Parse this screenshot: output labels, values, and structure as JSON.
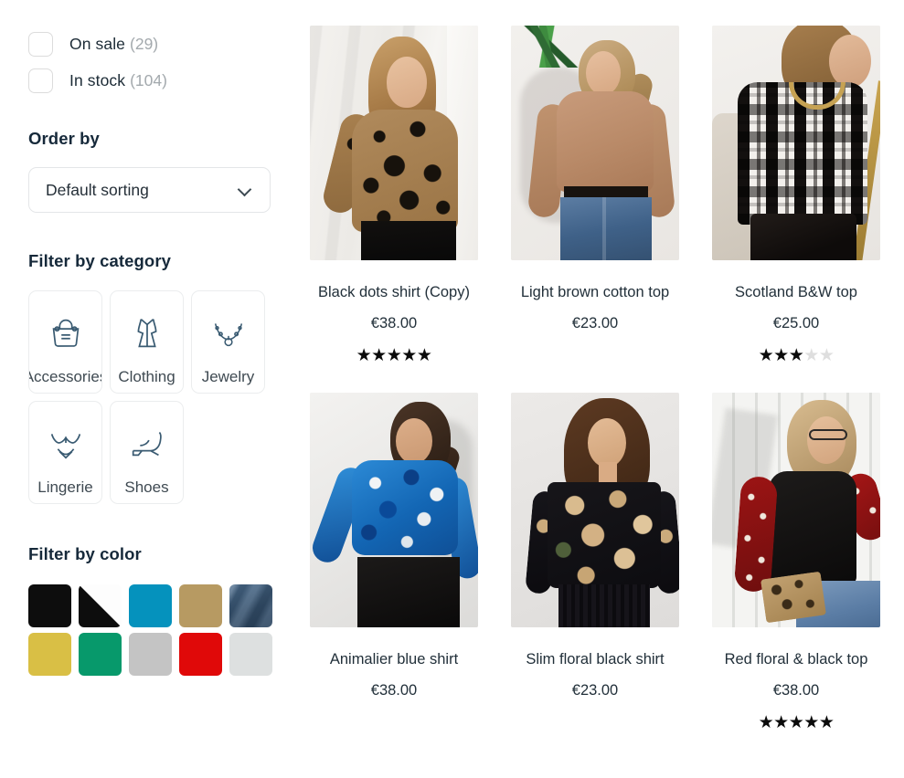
{
  "sidebar": {
    "availability": [
      {
        "label": "On sale",
        "count": "(29)",
        "checked": false
      },
      {
        "label": "In stock",
        "count": "(104)",
        "checked": false
      }
    ],
    "order_by": {
      "title": "Order by",
      "selected": "Default sorting"
    },
    "category": {
      "title": "Filter by category",
      "items": [
        {
          "label": "Accessories",
          "icon": "handbag-icon"
        },
        {
          "label": "Clothing",
          "icon": "dress-icon"
        },
        {
          "label": "Jewelry",
          "icon": "necklace-icon"
        },
        {
          "label": "Lingerie",
          "icon": "bra-icon"
        },
        {
          "label": "Shoes",
          "icon": "heel-shoe-icon"
        }
      ]
    },
    "color": {
      "title": "Filter by color",
      "swatches": [
        {
          "name": "black",
          "hex": "#0d0d0d"
        },
        {
          "name": "black-and-white",
          "hex": "#0d0d0d"
        },
        {
          "name": "blue",
          "hex": "#0592bd"
        },
        {
          "name": "tan",
          "hex": "#b79a62"
        },
        {
          "name": "denim",
          "hex": "#3d5e80"
        },
        {
          "name": "yellow",
          "hex": "#d9bf45"
        },
        {
          "name": "green",
          "hex": "#07996b"
        },
        {
          "name": "gray",
          "hex": "#c4c4c4"
        },
        {
          "name": "red",
          "hex": "#e00909"
        },
        {
          "name": "light-gray",
          "hex": "#dde0e0"
        }
      ]
    }
  },
  "products": [
    {
      "title": "Black dots shirt (Copy)",
      "price": "€38.00",
      "rating": 5,
      "max_rating": 5,
      "photo": "p1"
    },
    {
      "title": "Light brown cotton top",
      "price": "€23.00",
      "rating": 0,
      "max_rating": 5,
      "photo": "p2"
    },
    {
      "title": "Scotland B&W top",
      "price": "€25.00",
      "rating": 3,
      "max_rating": 5,
      "photo": "p3"
    },
    {
      "title": "Animalier blue shirt",
      "price": "€38.00",
      "rating": 0,
      "max_rating": 5,
      "photo": "p4"
    },
    {
      "title": "Slim floral black shirt",
      "price": "€23.00",
      "rating": 0,
      "max_rating": 5,
      "photo": "p5"
    },
    {
      "title": "Red floral & black top",
      "price": "€38.00",
      "rating": 5,
      "max_rating": 5,
      "photo": "p6"
    }
  ]
}
